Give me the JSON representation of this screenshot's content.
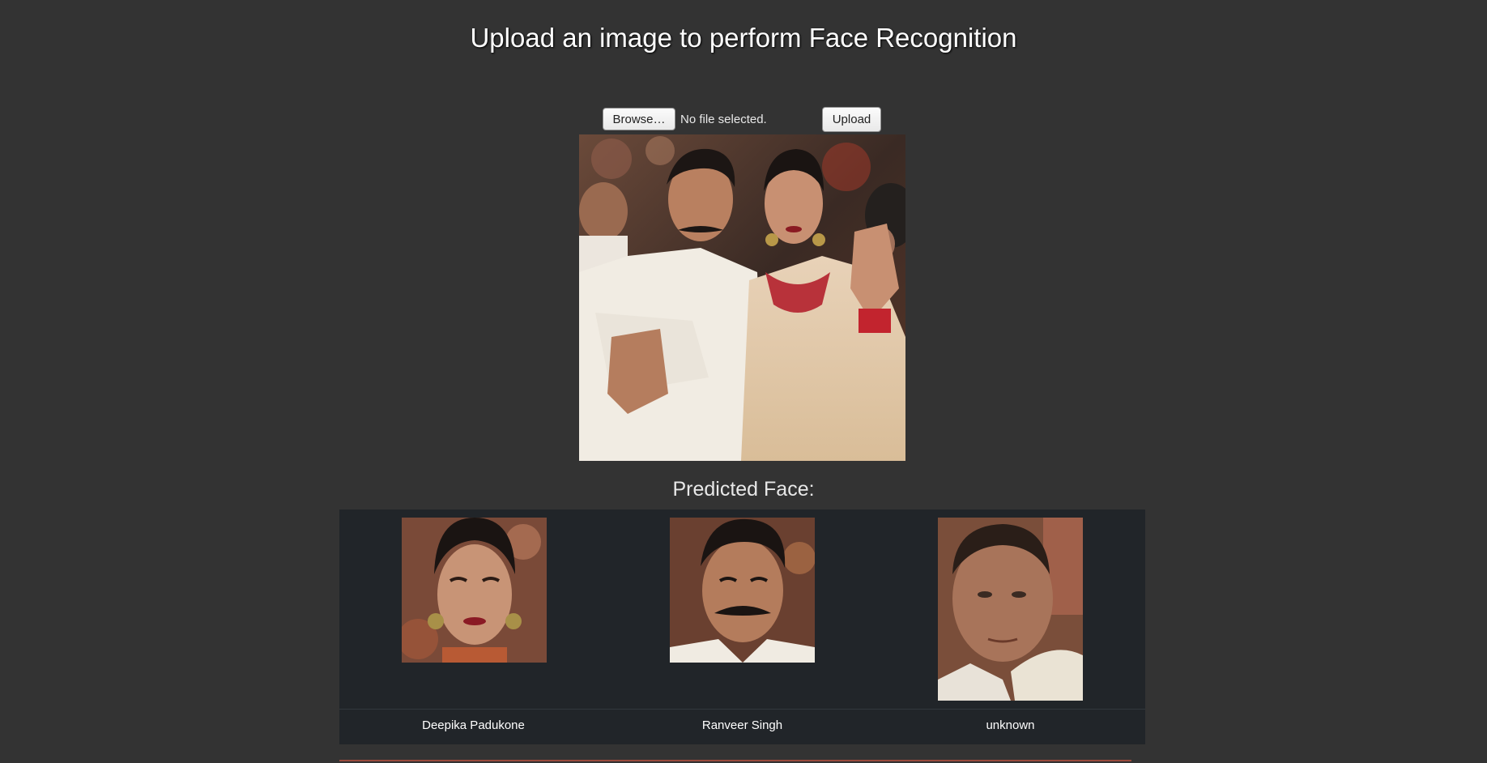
{
  "header": {
    "title": "Upload an image to perform Face Recognition"
  },
  "upload": {
    "browse_label": "Browse…",
    "file_status": "No file selected.",
    "upload_label": "Upload"
  },
  "results": {
    "heading": "Predicted Face:",
    "faces": [
      {
        "name": "Deepika Padukone"
      },
      {
        "name": "Ranveer Singh"
      },
      {
        "name": "unknown"
      }
    ]
  }
}
